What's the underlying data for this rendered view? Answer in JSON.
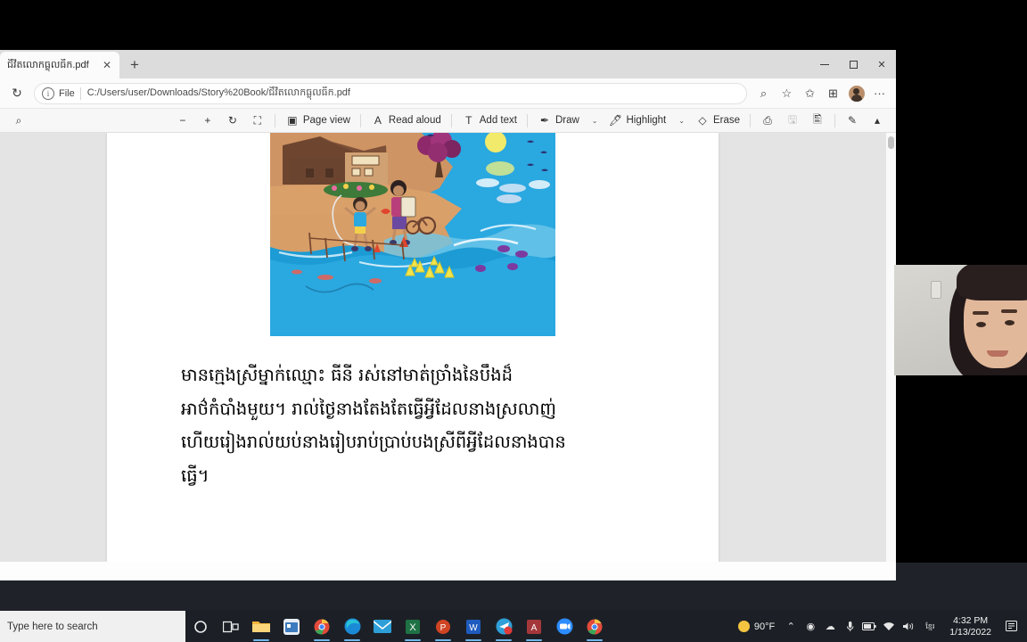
{
  "browser": {
    "tab": {
      "title": "ជីវិតលោកធ្លុលធីក.pdf",
      "close_label": "✕"
    },
    "newtab_label": "+",
    "window_controls": {
      "minimize": "—",
      "maximize": "❐",
      "close": "✕"
    },
    "address": {
      "refresh_icon": "↻",
      "info_icon": "i",
      "file_label": "File",
      "url": "C:/Users/user/Downloads/Story%20Book/ជីវិតលោកធ្លុលធីក.pdf"
    },
    "toolbar_right": [
      {
        "name": "zoom-search-icon",
        "glyph": "⌕"
      },
      {
        "name": "favorites-icon",
        "glyph": "☆"
      },
      {
        "name": "collections-icon",
        "glyph": "✩"
      },
      {
        "name": "add-to-collection-icon",
        "glyph": "⊞"
      },
      {
        "name": "profile-avatar",
        "glyph": ""
      },
      {
        "name": "settings-more-icon",
        "glyph": "···"
      }
    ]
  },
  "pdf_toolbar": {
    "search_icon": "⌕",
    "zoom_out": "−",
    "zoom_in": "+",
    "rotate": "↻",
    "fit_page": "⛶",
    "page_view": {
      "label": "Page view",
      "icon": "▣"
    },
    "read_aloud": {
      "label": "Read aloud",
      "icon": "A"
    },
    "add_text": {
      "label": "Add text",
      "icon": "T"
    },
    "draw": {
      "label": "Draw",
      "icon": "✒",
      "chevron": "⌄"
    },
    "highlight": {
      "label": "Highlight",
      "icon": "🖊",
      "chevron": "⌄"
    },
    "erase": {
      "label": "Erase",
      "icon": "◇"
    },
    "print": {
      "icon": "⎙"
    },
    "save": {
      "icon": "🖫"
    },
    "save_as": {
      "icon": "🖺"
    },
    "pin": {
      "icon": "✎"
    },
    "collapse": {
      "icon": "▴"
    }
  },
  "document": {
    "lines": [
      "មានក្មេងស្រីម្នាក់ឈ្មោះ ធីនី រស់នៅមាត់ច្រាំងនៃបឹងដ៏",
      "អាថ៌កំបាំងមួយ។ រាល់ថ្ងៃនាងតែងតែធ្វើអ្វីដែលនាងស្រលាញ់",
      "ហើយរៀងរាល់យប់នាងរៀបរាប់ប្រាប់បងស្រីពីអ្វីដែលនាងបាន",
      "ធ្វើ។"
    ],
    "illustration_alt": "house-by-lake-with-two-children-illustration"
  },
  "taskbar": {
    "search_placeholder": "Type here to search",
    "icons": [
      {
        "name": "cortana-icon",
        "glyph": "◯"
      },
      {
        "name": "task-view-icon",
        "glyph": "❑"
      },
      {
        "name": "file-explorer-icon",
        "glyph": ""
      },
      {
        "name": "microsoft-store-icon",
        "glyph": ""
      },
      {
        "name": "chrome-icon",
        "glyph": ""
      },
      {
        "name": "edge-icon",
        "glyph": ""
      },
      {
        "name": "mail-icon",
        "glyph": ""
      },
      {
        "name": "excel-icon",
        "glyph": "X"
      },
      {
        "name": "powerpoint-icon",
        "glyph": "P"
      },
      {
        "name": "word-icon",
        "glyph": "W"
      },
      {
        "name": "telegram-icon",
        "glyph": ""
      },
      {
        "name": "access-icon",
        "glyph": "A"
      },
      {
        "name": "zoom-icon",
        "glyph": "▸"
      },
      {
        "name": "chrome-second-icon",
        "glyph": ""
      }
    ],
    "tray": {
      "weather": "90°F",
      "show_hidden": "⌃",
      "items": [
        {
          "name": "webcam-tray-icon",
          "glyph": "◉"
        },
        {
          "name": "onedrive-tray-icon",
          "glyph": "☁"
        },
        {
          "name": "microphone-tray-icon",
          "glyph": "🎤"
        },
        {
          "name": "battery-tray-icon",
          "glyph": "▬"
        },
        {
          "name": "wifi-tray-icon",
          "glyph": "᯾"
        },
        {
          "name": "volume-tray-icon",
          "glyph": "🔊"
        },
        {
          "name": "language-tray-icon",
          "glyph": "ខ្មែរ"
        }
      ],
      "time": "4:32 PM",
      "date": "1/13/2022",
      "action_center": "🗒"
    }
  },
  "colors": {
    "accent": "#2aa8e0",
    "taskbar": "#1c2026",
    "viewer_bg": "#e4e4e4",
    "page_bg": "#ffffff"
  }
}
